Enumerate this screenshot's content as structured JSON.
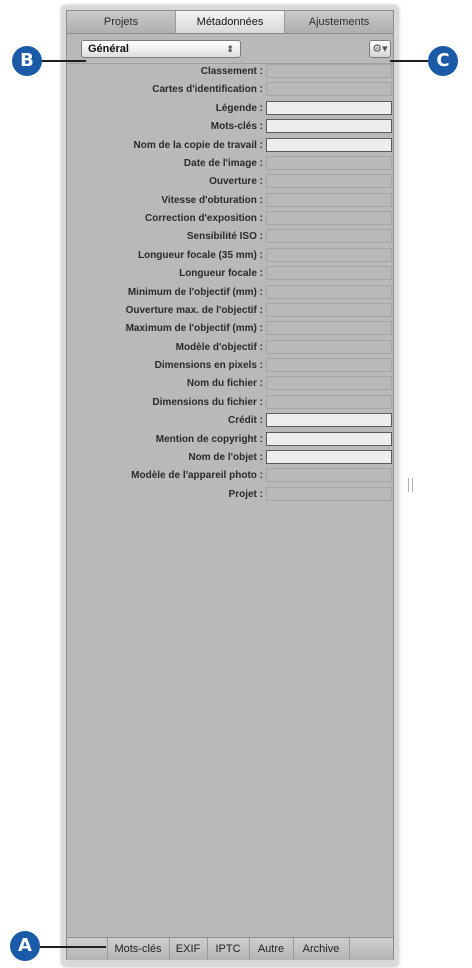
{
  "tabs": [
    {
      "label": "Projets",
      "active": false
    },
    {
      "label": "Métadonnées",
      "active": true
    },
    {
      "label": "Ajustements",
      "active": false
    }
  ],
  "toolbar": {
    "preset": "Général",
    "select_arrows": "⇕",
    "gear_icon": "⚙▾"
  },
  "fields": [
    {
      "label": "Classement :",
      "editable": false
    },
    {
      "label": "Cartes d'identification :",
      "editable": false
    },
    {
      "label": "Légende :",
      "editable": true
    },
    {
      "label": "Mots-clés :",
      "editable": true
    },
    {
      "label": "Nom de la copie de travail :",
      "editable": true
    },
    {
      "label": "Date de l'image :",
      "editable": false
    },
    {
      "label": "Ouverture :",
      "editable": false
    },
    {
      "label": "Vitesse d'obturation :",
      "editable": false
    },
    {
      "label": "Correction d'exposition :",
      "editable": false
    },
    {
      "label": "Sensibilité ISO :",
      "editable": false
    },
    {
      "label": "Longueur focale (35 mm) :",
      "editable": false
    },
    {
      "label": "Longueur focale :",
      "editable": false
    },
    {
      "label": "Minimum de l'objectif (mm) :",
      "editable": false
    },
    {
      "label": "Ouverture max. de l'objectif :",
      "editable": false
    },
    {
      "label": "Maximum de l'objectif (mm) :",
      "editable": false
    },
    {
      "label": "Modèle d'objectif :",
      "editable": false
    },
    {
      "label": "Dimensions en pixels :",
      "editable": false
    },
    {
      "label": "Nom du fichier :",
      "editable": false
    },
    {
      "label": "Dimensions du fichier :",
      "editable": false
    },
    {
      "label": "Crédit :",
      "editable": true
    },
    {
      "label": "Mention de copyright :",
      "editable": true
    },
    {
      "label": "Nom de l'objet :",
      "editable": true
    },
    {
      "label": "Modèle de l'appareil photo :",
      "editable": false
    },
    {
      "label": "Projet :",
      "editable": false
    }
  ],
  "bottom_bar": {
    "buttons": [
      "Mots-clés",
      "EXIF",
      "IPTC",
      "Autre",
      "Archive"
    ]
  },
  "callouts": {
    "a": "A",
    "b": "B",
    "c": "C"
  },
  "colors": {
    "callout": "#1a5aa6",
    "panel": "#b9b9b9"
  }
}
